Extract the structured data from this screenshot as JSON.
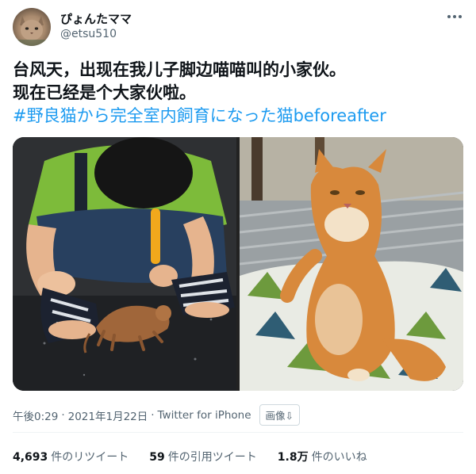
{
  "author": {
    "display_name": "ぴょんたママ",
    "handle": "@etsu510"
  },
  "tweet": {
    "line1": "台风天，出现在我儿子脚边喵喵叫的小家伙。",
    "line2": "现在已经是个大家伙啦。",
    "hashtag": "#野良猫から完全室内飼育になった猫beforeafter"
  },
  "media": [
    {
      "icon": "photo-boy-wet-kitten"
    },
    {
      "icon": "photo-orange-cat-sitting"
    }
  ],
  "meta": {
    "time": "午後0:29",
    "separator": "·",
    "date": "2021年1月22日",
    "source": "Twitter for iPhone",
    "translate_label": "画像⇩"
  },
  "stats": {
    "retweets": {
      "count": "4,693",
      "label": "件のリツイート"
    },
    "quotes": {
      "count": "59",
      "label": "件の引用ツイート"
    },
    "likes": {
      "count": "1.8万",
      "label": "件のいいね"
    }
  },
  "colors": {
    "link": "#1d9bf0",
    "secondary_text": "#536471",
    "primary_text": "#0f1419"
  }
}
